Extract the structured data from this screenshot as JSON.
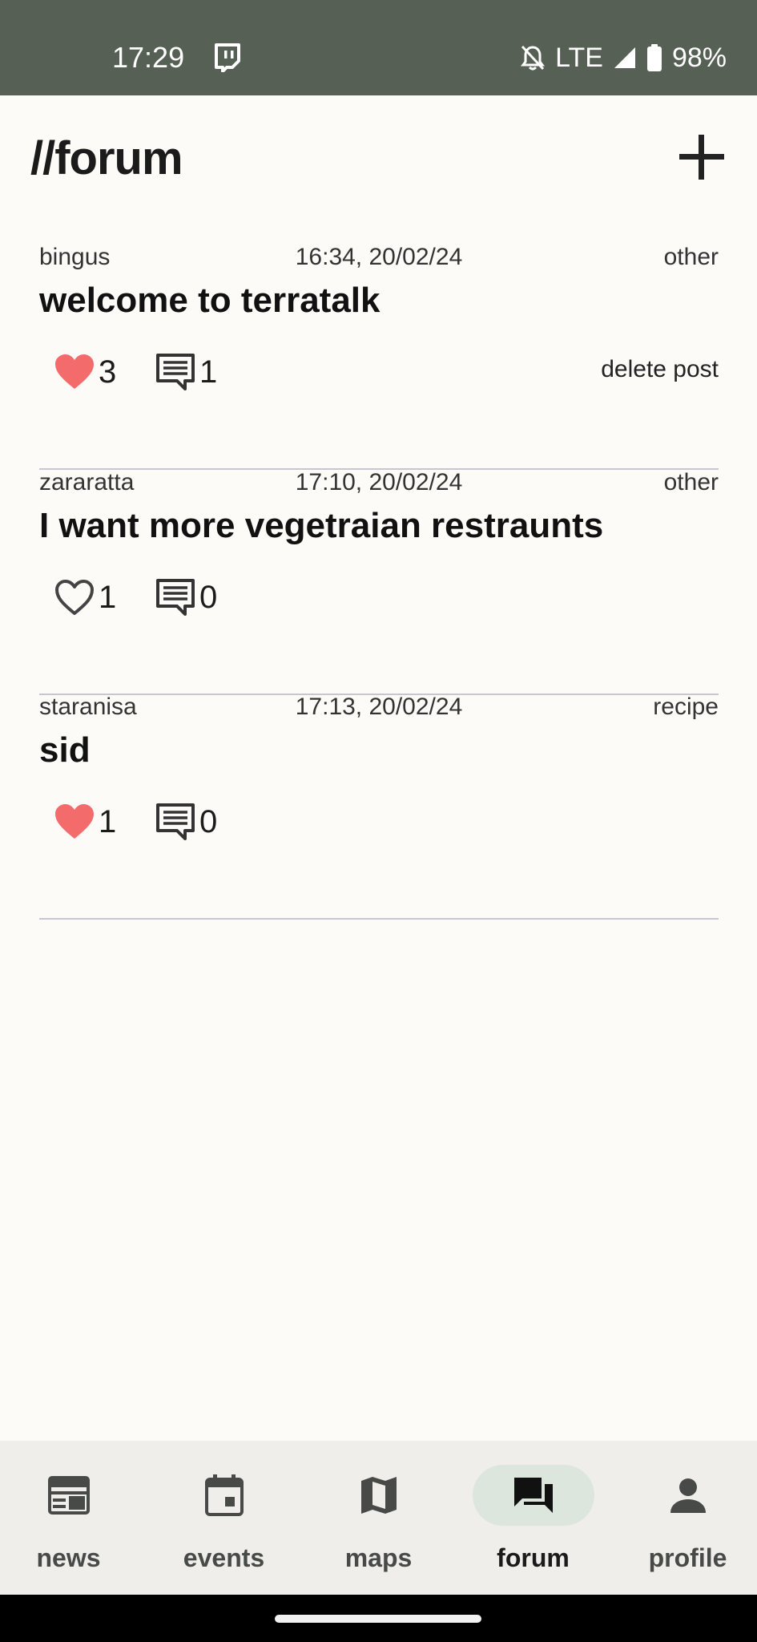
{
  "status_bar": {
    "time": "17:29",
    "network": "LTE",
    "battery": "98%",
    "icons": [
      "twitch-icon",
      "bell-off-icon",
      "signal-icon",
      "battery-icon"
    ]
  },
  "header": {
    "title": "//forum",
    "add_icon": "plus-icon"
  },
  "posts": [
    {
      "user": "bingus",
      "timestamp": "16:34, 20/02/24",
      "category": "other",
      "title": "welcome to terratalk",
      "likes": "3",
      "liked": true,
      "comments": "1",
      "delete_label": "delete post"
    },
    {
      "user": "zararatta",
      "timestamp": "17:10, 20/02/24",
      "category": "other",
      "title": "I want more vegetraian restraunts",
      "likes": "1",
      "liked": false,
      "comments": "0"
    },
    {
      "user": "staranisa",
      "timestamp": "17:13, 20/02/24",
      "category": "recipe",
      "title": "sid",
      "likes": "1",
      "liked": true,
      "comments": "0"
    }
  ],
  "bottom_nav": {
    "items": [
      {
        "label": "news",
        "icon": "newspaper-icon",
        "active": false
      },
      {
        "label": "events",
        "icon": "calendar-icon",
        "active": false
      },
      {
        "label": "maps",
        "icon": "map-icon",
        "active": false
      },
      {
        "label": "forum",
        "icon": "forum-icon",
        "active": true
      },
      {
        "label": "profile",
        "icon": "person-icon",
        "active": false
      }
    ]
  },
  "colors": {
    "status_bar": "#566055",
    "background": "#fcfbf8",
    "heart_filled": "#f36b6b",
    "active_pill": "#dce6dc",
    "divider": "#c8c7cf"
  }
}
